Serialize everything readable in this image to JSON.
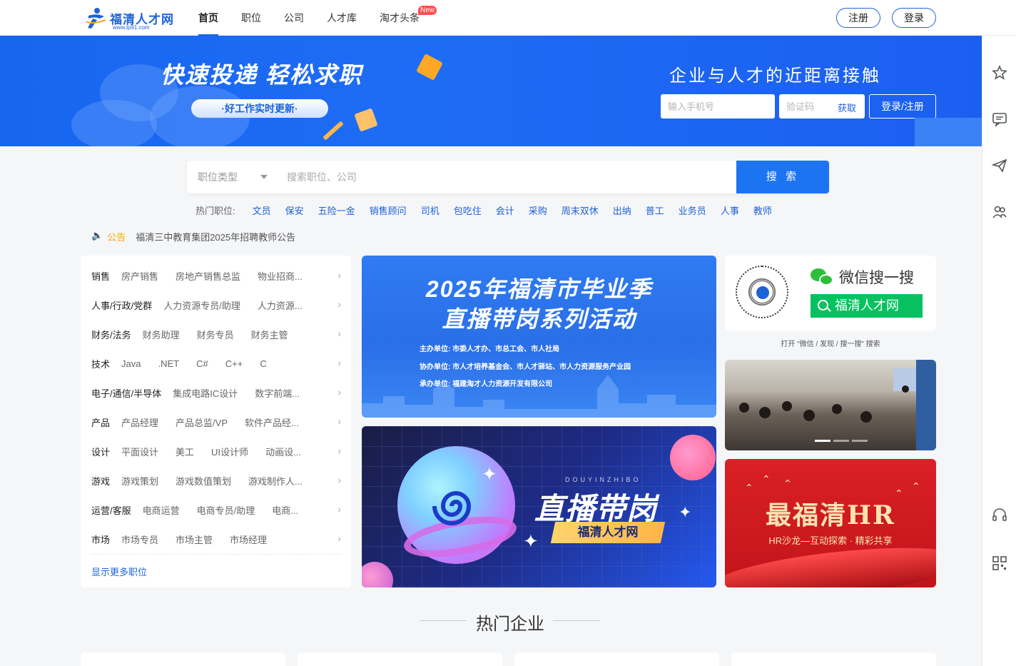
{
  "header": {
    "logo_name": "福清人才网",
    "logo_url": "www.lp91.com",
    "nav": [
      {
        "label": "首页",
        "active": true
      },
      {
        "label": "职位"
      },
      {
        "label": "公司"
      },
      {
        "label": "人才库"
      },
      {
        "label": "淘才头条",
        "badge": "New"
      }
    ],
    "register_label": "注册",
    "login_label": "登录"
  },
  "banner": {
    "slogan": "快速投递 轻松求职",
    "pill": "·好工作实时更新·",
    "tagline": "企业与人才的近距离接触",
    "phone_placeholder": "输入手机号",
    "code_placeholder": "验证码",
    "get_code_label": "获取",
    "login_register_label": "登录/注册"
  },
  "search": {
    "type_label": "职位类型",
    "placeholder": "搜索职位、公司",
    "button_label": "搜 索",
    "hot_label": "热门职位:",
    "hot_tags": [
      "文员",
      "保安",
      "五险一金",
      "销售顾问",
      "司机",
      "包吃住",
      "会计",
      "采购",
      "周末双休",
      "出纳",
      "普工",
      "业务员",
      "人事",
      "教师"
    ]
  },
  "notice": {
    "label": "公告",
    "text": "福清三中教育集团2025年招聘教师公告"
  },
  "categories": [
    {
      "main": "销售",
      "subs": [
        "房产销售",
        "房地产销售总监",
        "物业招商..."
      ]
    },
    {
      "main": "人事/行政/党群",
      "subs": [
        "人力资源专员/助理",
        "人力资源..."
      ]
    },
    {
      "main": "财务/法务",
      "subs": [
        "财务助理",
        "财务专员",
        "财务主管"
      ]
    },
    {
      "main": "技术",
      "subs": [
        "Java",
        ".NET",
        "C#",
        "C++",
        "C"
      ]
    },
    {
      "main": "电子/通信/半导体",
      "subs": [
        "集成电路IC设计",
        "数字前端..."
      ]
    },
    {
      "main": "产品",
      "subs": [
        "产品经理",
        "产品总监/VP",
        "软件产品经..."
      ]
    },
    {
      "main": "设计",
      "subs": [
        "平面设计",
        "美工",
        "UI设计师",
        "动画设..."
      ]
    },
    {
      "main": "游戏",
      "subs": [
        "游戏策划",
        "游戏数值策划",
        "游戏制作人..."
      ]
    },
    {
      "main": "运营/客服",
      "subs": [
        "电商运营",
        "电商专员/助理",
        "电商..."
      ]
    },
    {
      "main": "市场",
      "subs": [
        "市场专员",
        "市场主管",
        "市场经理"
      ]
    }
  ],
  "more_positions_label": "显示更多职位",
  "promo1": {
    "line1": "2025年福清市毕业季",
    "line2": "直播带岗系列活动",
    "organizers": [
      "主办单位: 市委人才办、市总工会、市人社局",
      "协办单位: 市人才培养基金会、市人才驿站、市人力资源服务产业园",
      "承办单位: 福建淘才人力资源开发有限公司"
    ]
  },
  "promo2": {
    "pinyin": "DOUYINZHIBO",
    "title": "直播带岗",
    "tag": "福清人才网"
  },
  "wechat": {
    "title": "微信搜一搜",
    "button": "福清人才网",
    "hint": "打开 \"微信 / 发现 / 搜一搜\" 搜索"
  },
  "hr_salon": {
    "title": "最福清HR",
    "subtitle": "HR沙龙—互动探索 · 精彩共享"
  },
  "hot_companies_title": "热门企业",
  "sidebar_icons": [
    "star-icon",
    "message-icon",
    "send-icon",
    "users-icon",
    "headset-icon",
    "qrcode-icon"
  ],
  "colors": {
    "brand_blue": "#1d63d8",
    "search_blue": "#1d74f2",
    "wechat_green": "#07c160",
    "notice_orange": "#f5a623"
  }
}
